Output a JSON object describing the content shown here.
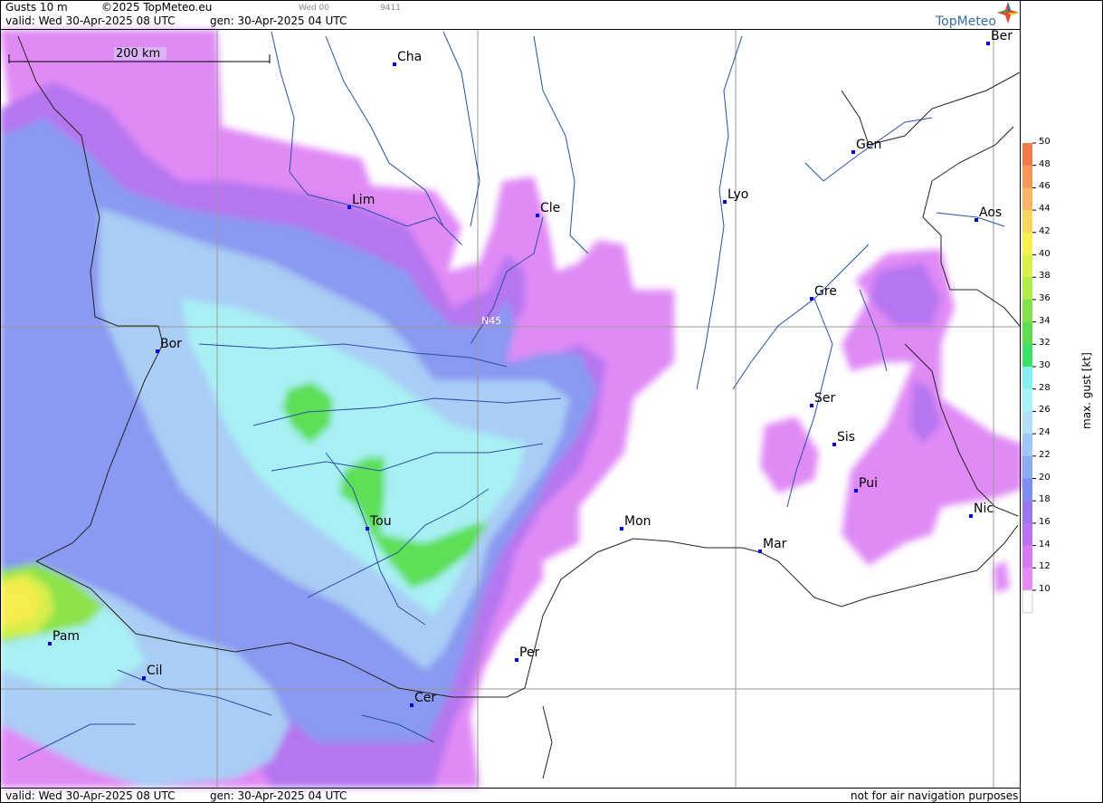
{
  "header": {
    "title": "Gusts 10 m",
    "copyright": "©2025 TopMeteo.eu",
    "run_label": "Wed 00",
    "run_code": "9411",
    "valid": "valid:  Wed  30-Apr-2025  08 UTC",
    "generated": "gen: 30-Apr-2025 04 UTC",
    "logo": "TopMeteo"
  },
  "footer": {
    "valid": "valid:  Wed  30-Apr-2025  08 UTC",
    "generated": "gen: 30-Apr-2025 04 UTC",
    "disclaimer": "not for air navigation purposes"
  },
  "scale_bar": {
    "label": "200 km"
  },
  "grid_label": "N45",
  "cities": [
    {
      "name": "Cha"
    },
    {
      "name": "Ber"
    },
    {
      "name": "Gen"
    },
    {
      "name": "Lim"
    },
    {
      "name": "Cle"
    },
    {
      "name": "Lyo"
    },
    {
      "name": "Aos"
    },
    {
      "name": "Gre"
    },
    {
      "name": "Bor"
    },
    {
      "name": "Ser"
    },
    {
      "name": "Sis"
    },
    {
      "name": "Pui"
    },
    {
      "name": "Tou"
    },
    {
      "name": "Mon"
    },
    {
      "name": "Nic"
    },
    {
      "name": "Mar"
    },
    {
      "name": "Pam"
    },
    {
      "name": "Per"
    },
    {
      "name": "Cil"
    },
    {
      "name": "Cer"
    }
  ],
  "legend": {
    "title": "max. gust  [kt]",
    "levels": [
      "50",
      "48",
      "46",
      "44",
      "42",
      "40",
      "38",
      "36",
      "34",
      "32",
      "30",
      "28",
      "26",
      "24",
      "22",
      "20",
      "18",
      "16",
      "14",
      "12",
      "10"
    ],
    "colors": [
      "#f47a4c",
      "#f7985a",
      "#f9b563",
      "#fad55d",
      "#f5ef4f",
      "#d9f04c",
      "#b0ec4a",
      "#86e24c",
      "#5fdd52",
      "#3fe06a",
      "#86f0f4",
      "#a9f3f6",
      "#b3dff8",
      "#9fc8f5",
      "#89aef2",
      "#7e8ff0",
      "#9b77ef",
      "#b973ef",
      "#d87bf3",
      "#e68af5"
    ],
    "background": "#ffffff"
  }
}
